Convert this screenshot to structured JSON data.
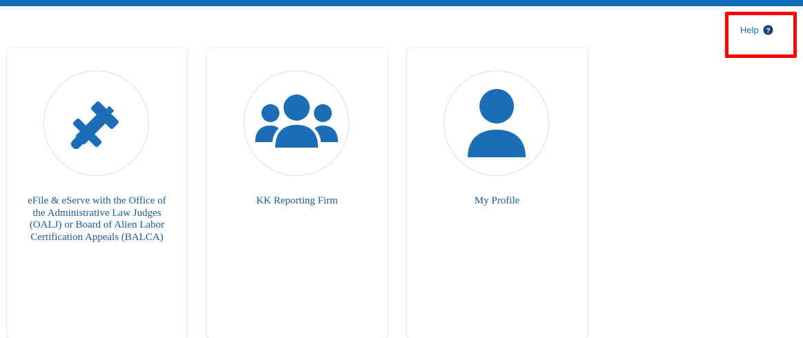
{
  "header": {
    "help_label": "Help",
    "help_icon": "question-circle-icon",
    "accent_color": "#0b6fb9",
    "highlight_color": "#ff0000"
  },
  "cards": [
    {
      "icon": "gavel-icon",
      "label": "eFile & eServe with the Office of the Administrative Law Judges (OALJ) or Board of Alien Labor Certification Appeals (BALCA)"
    },
    {
      "icon": "users-group-icon",
      "label": "KK Reporting Firm"
    },
    {
      "icon": "user-icon",
      "label": "My Profile"
    }
  ],
  "colors": {
    "icon_blue": "#1b6eb5",
    "label_blue": "#1b5c9a"
  }
}
